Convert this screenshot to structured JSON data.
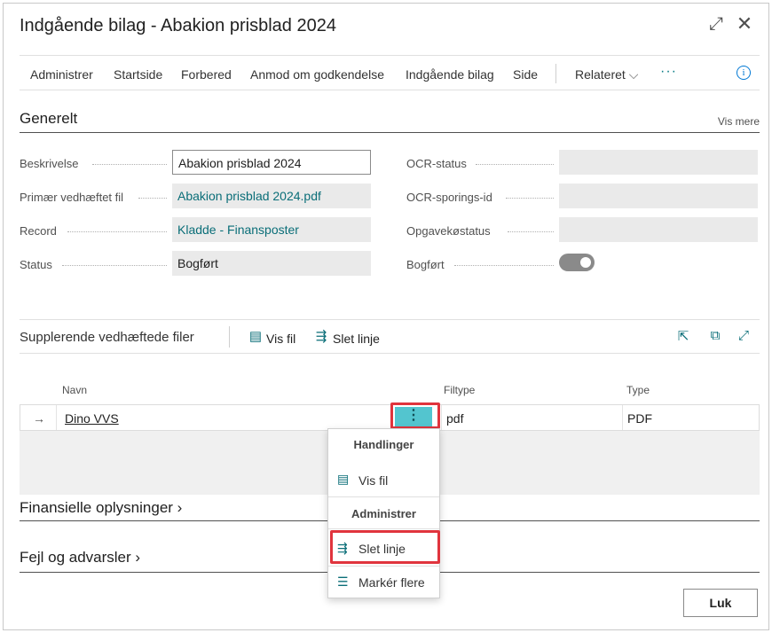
{
  "title": "Indgående bilag - Abakion prisblad 2024",
  "window_icons": {
    "expand": "expand-icon",
    "close": "close-icon"
  },
  "actions": [
    "Administrer",
    "Startside",
    "Forbered",
    "Anmod om godkendelse",
    "Indgående bilag",
    "Side",
    "Relateret",
    "···"
  ],
  "general": {
    "heading": "Generelt",
    "show_more": "Vis mere",
    "left_fields": [
      {
        "label": "Beskrivelse",
        "value": "Abakion prisblad 2024"
      },
      {
        "label": "Primær vedhæftet fil",
        "value": "Abakion prisblad 2024.pdf"
      },
      {
        "label": "Record",
        "value": "Kladde - Finansposter"
      },
      {
        "label": "Status",
        "value": "Bogført"
      }
    ],
    "right_fields": [
      {
        "label": "OCR-status",
        "value": ""
      },
      {
        "label": "OCR-sporings-id",
        "value": ""
      },
      {
        "label": "Opgavekøstatus",
        "value": ""
      },
      {
        "label": "Bogført",
        "value": ""
      }
    ],
    "posted_toggle_on": true
  },
  "attachments": {
    "title": "Supplerende vedhæftede filer",
    "actions": [
      "Vis fil",
      "Slet linje"
    ],
    "columns": [
      "Navn",
      "Filtype",
      "Type"
    ],
    "rows": [
      {
        "name": "Dino VVS",
        "filetype": "pdf",
        "type": "PDF"
      }
    ]
  },
  "context_menu": {
    "header1": "Handlinger",
    "item_view": "Vis fil",
    "header2": "Administrer",
    "item_delete": "Slet linje",
    "item_select_more": "Markér flere"
  },
  "sections": [
    "Finansielle oplysninger",
    "Fejl og advarsler"
  ],
  "close_button": "Luk",
  "colors": {
    "accent": "#0a6e78",
    "highlight": "#e0343d",
    "selected_cell": "#53c5cf"
  }
}
